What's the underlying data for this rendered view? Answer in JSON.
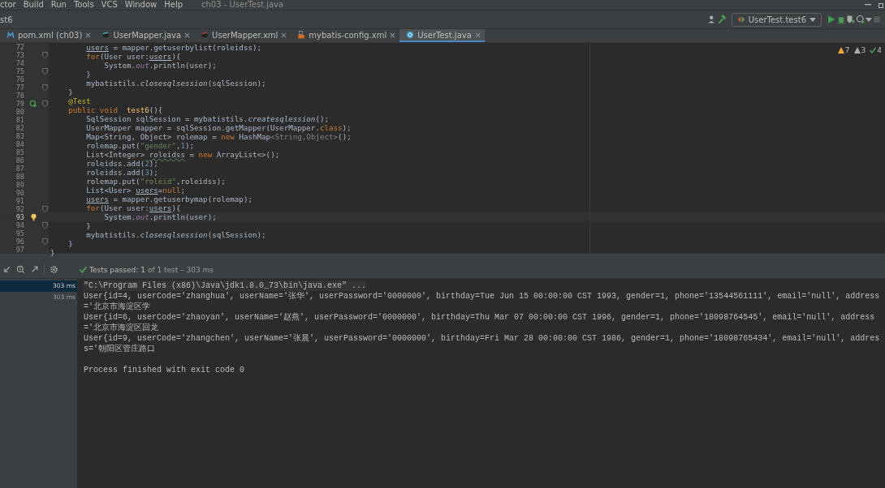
{
  "menu": {
    "items": [
      "ctor",
      "Build",
      "Run",
      "Tools",
      "VCS",
      "Window",
      "Help"
    ],
    "title": "ch03 - UserTest.java"
  },
  "navbar": {
    "crumb": "st6",
    "run_config": "UserTest.test6"
  },
  "tabs": [
    {
      "label": "pom.xml (ch03)",
      "selected": false
    },
    {
      "label": "UserMapper.java",
      "selected": false
    },
    {
      "label": "UserMapper.xml",
      "selected": false
    },
    {
      "label": "mybatis-config.xml",
      "selected": false
    },
    {
      "label": "UserTest.java",
      "selected": true
    }
  ],
  "inspections": {
    "warnings": "7",
    "weak": "3",
    "ok": "4"
  },
  "code": [
    {
      "number": "72",
      "current": false,
      "fold": false,
      "segments": [
        {
          "kind": "ref",
          "text": "        users"
        },
        {
          "kind": "plain",
          "text": " = mapper.getuserbylist(roleidss);"
        }
      ]
    },
    {
      "number": "73",
      "current": false,
      "fold": true,
      "segments": [
        {
          "kind": "keyword",
          "text": "        for"
        },
        {
          "kind": "plain",
          "text": "(User user:"
        },
        {
          "kind": "ref",
          "text": "users"
        },
        {
          "kind": "plain",
          "text": "){"
        }
      ]
    },
    {
      "number": "74",
      "current": false,
      "fold": false,
      "segments": [
        {
          "kind": "plain",
          "text": "            System."
        },
        {
          "kind": "static",
          "text": "out"
        },
        {
          "kind": "plain",
          "text": ".println(user);"
        }
      ]
    },
    {
      "number": "75",
      "current": false,
      "fold": true,
      "segments": [
        {
          "kind": "plain",
          "text": "        }"
        }
      ]
    },
    {
      "number": "76",
      "current": false,
      "fold": false,
      "segments": [
        {
          "kind": "plain",
          "text": "        mybatistils."
        },
        {
          "kind": "italic",
          "text": "closesqlsession"
        },
        {
          "kind": "plain",
          "text": "(sqlSession);"
        }
      ]
    },
    {
      "number": "77",
      "current": false,
      "fold": true,
      "segments": [
        {
          "kind": "plain",
          "text": "    }"
        }
      ]
    },
    {
      "number": "78",
      "current": false,
      "fold": false,
      "segments": [
        {
          "kind": "annotation",
          "text": "    @Test"
        }
      ]
    },
    {
      "number": "79",
      "current": false,
      "fold": true,
      "kind": "runnable",
      "segments": [
        {
          "kind": "keyword",
          "text": "    public void  "
        },
        {
          "kind": "decl",
          "text": "test6"
        },
        {
          "kind": "plain",
          "text": "(){"
        }
      ]
    },
    {
      "number": "80",
      "current": false,
      "fold": false
    },
    {
      "number": "81",
      "current": false,
      "fold": false,
      "segments": [
        {
          "kind": "plain",
          "text": "        SqlSession sqlSession = mybatistils."
        },
        {
          "kind": "italic",
          "text": "createsqlession"
        },
        {
          "kind": "plain",
          "text": "();"
        }
      ]
    },
    {
      "number": "82",
      "current": false,
      "fold": false,
      "segments": [
        {
          "kind": "plain",
          "text": "        UserMapper mapper = sqlSession.getMapper(UserMapper."
        },
        {
          "kind": "keyword",
          "text": "class"
        },
        {
          "kind": "plain",
          "text": ");"
        }
      ]
    },
    {
      "number": "83",
      "current": false,
      "fold": false,
      "segments": [
        {
          "kind": "plain",
          "text": "        Map<String, Object> rolemap = "
        },
        {
          "kind": "keyword",
          "text": "new"
        },
        {
          "kind": "plain",
          "text": " HashMap"
        },
        {
          "kind": "generic",
          "text": "<String,Object>"
        },
        {
          "kind": "plain",
          "text": "();"
        }
      ]
    },
    {
      "number": "84",
      "current": false,
      "fold": false,
      "segments": [
        {
          "kind": "plain",
          "text": "        rolemap.put("
        },
        {
          "kind": "string",
          "text": "\"gender\""
        },
        {
          "kind": "plain",
          "text": ","
        },
        {
          "kind": "number",
          "text": "1"
        },
        {
          "kind": "plain",
          "text": ");"
        }
      ]
    },
    {
      "number": "85",
      "current": false,
      "fold": false,
      "segments": [
        {
          "kind": "plain",
          "text": "        List<Integer> "
        },
        {
          "kind": "warn",
          "text": "roleidss"
        },
        {
          "kind": "plain",
          "text": " = "
        },
        {
          "kind": "keyword",
          "text": "new"
        },
        {
          "kind": "plain",
          "text": " ArrayList<>();"
        }
      ]
    },
    {
      "number": "86",
      "current": false,
      "fold": false,
      "segments": [
        {
          "kind": "plain",
          "text": "        roleidss.add("
        },
        {
          "kind": "number",
          "text": "2"
        },
        {
          "kind": "plain",
          "text": ");"
        }
      ]
    },
    {
      "number": "87",
      "current": false,
      "fold": false,
      "segments": [
        {
          "kind": "plain",
          "text": "        roleidss.add("
        },
        {
          "kind": "number",
          "text": "3"
        },
        {
          "kind": "plain",
          "text": ");"
        }
      ]
    },
    {
      "number": "88",
      "current": false,
      "fold": false,
      "segments": [
        {
          "kind": "plain",
          "text": "        rolemap.put("
        },
        {
          "kind": "string",
          "text": "\"roleid\""
        },
        {
          "kind": "plain",
          "text": ",roleidss);"
        }
      ]
    },
    {
      "number": "89",
      "current": false,
      "fold": false,
      "segments": [
        {
          "kind": "plain",
          "text": "        List<User> "
        },
        {
          "kind": "ref",
          "text": "users"
        },
        {
          "kind": "plain",
          "text": "="
        },
        {
          "kind": "keyword",
          "text": "null"
        },
        {
          "kind": "plain",
          "text": ";"
        }
      ]
    },
    {
      "number": "90",
      "current": false,
      "fold": false
    },
    {
      "number": "91",
      "current": false,
      "fold": false,
      "segments": [
        {
          "kind": "ref",
          "text": "        users"
        },
        {
          "kind": "plain",
          "text": " = mapper.getuserbymap(rolemap);"
        }
      ]
    },
    {
      "number": "92",
      "current": false,
      "fold": true,
      "segments": [
        {
          "kind": "keyword",
          "text": "        for"
        },
        {
          "kind": "plain",
          "text": "(User user:"
        },
        {
          "kind": "ref",
          "text": "users"
        },
        {
          "kind": "plain",
          "text": "){"
        }
      ]
    },
    {
      "number": "93",
      "current": true,
      "fold": false,
      "kind": "hint",
      "segments": [
        {
          "kind": "plain",
          "text": "            System."
        },
        {
          "kind": "static",
          "text": "out"
        },
        {
          "kind": "plain",
          "text": ".println(user);"
        }
      ]
    },
    {
      "number": "94",
      "current": false,
      "fold": true,
      "segments": [
        {
          "kind": "plain",
          "text": "        }"
        }
      ]
    },
    {
      "number": "95",
      "current": false,
      "fold": false,
      "segments": [
        {
          "kind": "plain",
          "text": "        mybatistils."
        },
        {
          "kind": "italic",
          "text": "closesqlsession"
        },
        {
          "kind": "plain",
          "text": "(sqlSession);"
        }
      ]
    },
    {
      "number": "96",
      "current": false,
      "fold": true,
      "segments": [
        {
          "kind": "plain",
          "text": "    }"
        }
      ]
    },
    {
      "number": "97",
      "current": false,
      "fold": false,
      "segments": [
        {
          "kind": "plain",
          "text": "}"
        }
      ]
    }
  ],
  "run_panel": {
    "status": {
      "label": "Tests passed:",
      "count": "1",
      "detail": "of 1 test – 303 ms"
    },
    "tree": [
      {
        "duration": "303 ms",
        "selected": true
      },
      {
        "duration": "303 ms",
        "selected": false
      }
    ],
    "console": [
      {
        "kind": "command",
        "text": "\"C:\\Program Files (x86)\\Java\\jdk1.8.0_73\\bin\\java.exe\" ..."
      },
      {
        "kind": "output",
        "text": "User{id=4, userCode='zhanghua', userName='张华', userPassword='0000000', birthday=Tue Jun 15 00:00:00 CST 1993, gender=1, phone='13544561111', email='null', address='北京市海淀区学"
      },
      {
        "kind": "output",
        "text": "User{id=6, userCode='zhaoyan', userName='赵燕', userPassword='0000000', birthday=Thu Mar 07 00:00:00 CST 1996, gender=1, phone='18098764545', email='null', address='北京市海淀区回龙"
      },
      {
        "kind": "output",
        "text": "User{id=9, userCode='zhangchen', userName='张晨', userPassword='0000000', birthday=Fri Mar 28 00:00:00 CST 1986, gender=1, phone='18098765434', email='null', address='朝阳区管庄路口"
      },
      {
        "kind": "blank"
      },
      {
        "kind": "output",
        "text": "Process finished with exit code 0"
      }
    ]
  }
}
